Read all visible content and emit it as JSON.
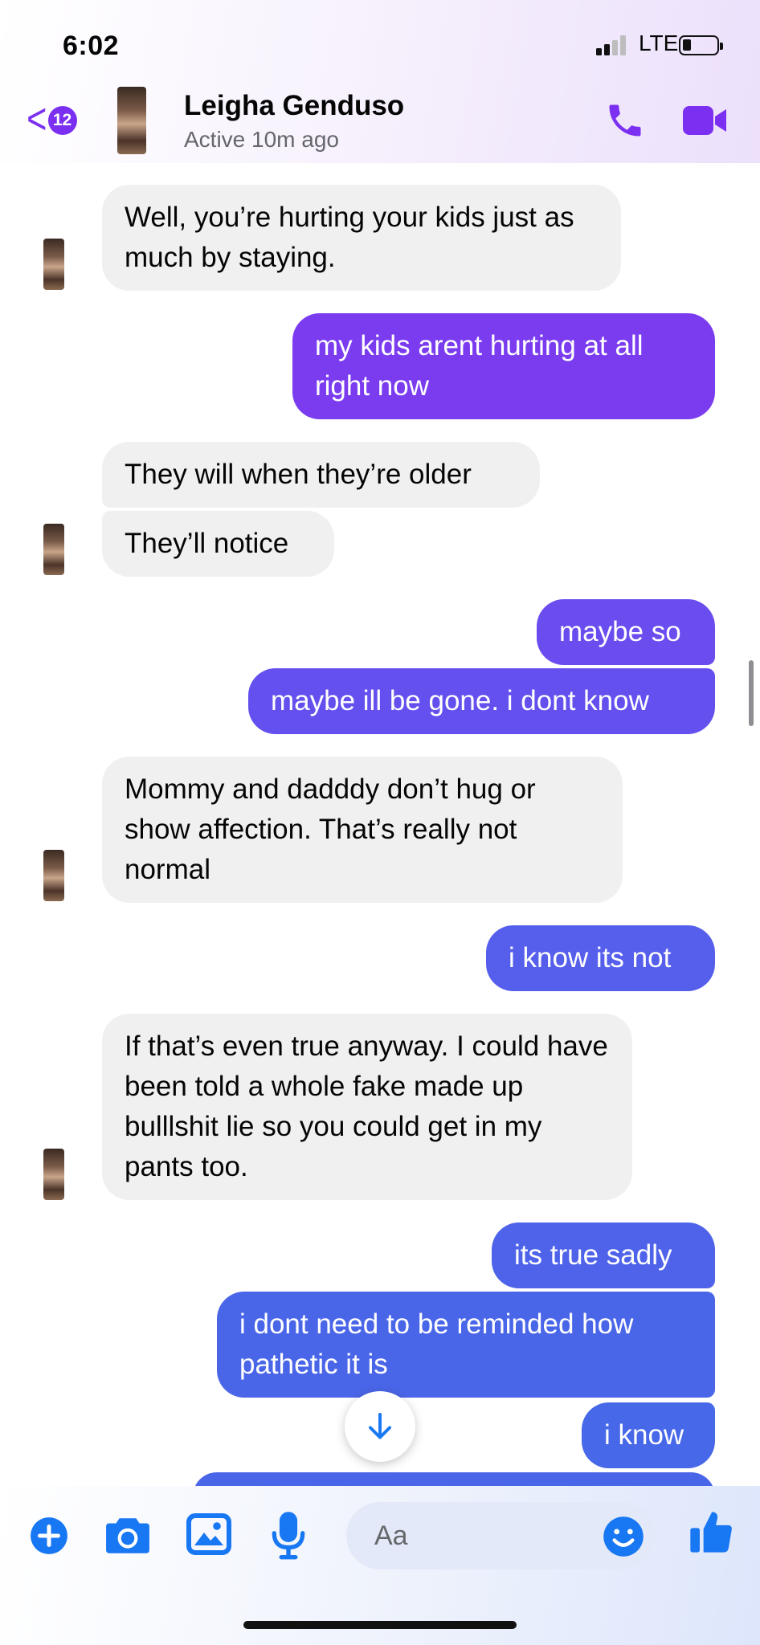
{
  "status_bar": {
    "time": "6:02",
    "network": "LTE"
  },
  "header": {
    "back_count": "12",
    "contact_name": "Leigha Genduso",
    "presence": "Active 10m ago",
    "call_icon": "phone-icon",
    "video_icon": "video-camera-icon",
    "accent_color": "#7b2ff0"
  },
  "messages": [
    {
      "from": "them",
      "text": "Well, you’re hurting your kids just as much by staying."
    },
    {
      "from": "me",
      "text": "my kids arent hurting at all right now"
    },
    {
      "from": "them",
      "text": "They will when they’re older"
    },
    {
      "from": "them",
      "text": "They’ll notice"
    },
    {
      "from": "me",
      "text": "maybe so"
    },
    {
      "from": "me",
      "text": "maybe ill be gone. i dont know"
    },
    {
      "from": "them",
      "text": "Mommy and dadddy don’t hug or show affection. That’s really not normal"
    },
    {
      "from": "me",
      "text": "i know its not"
    },
    {
      "from": "them",
      "text": "If that’s even true anyway. I could have been told a whole fake made up bulllshit lie so you could get in my pants too."
    },
    {
      "from": "me",
      "text": "its true sadly"
    },
    {
      "from": "me",
      "text": "i dont need to be reminded how pathetic it is"
    },
    {
      "from": "me",
      "text": "i know"
    }
  ],
  "composer": {
    "placeholder": "Aa",
    "icons": [
      "plus-icon",
      "camera-icon",
      "image-icon",
      "microphone-icon",
      "emoji-icon",
      "thumbs-up-icon"
    ]
  },
  "colors": {
    "incoming_bubble": "#f0f0f0",
    "outgoing_purple": "#7b3cf0",
    "outgoing_blue": "#4a66e8",
    "composer_icon": "#1877f2"
  }
}
